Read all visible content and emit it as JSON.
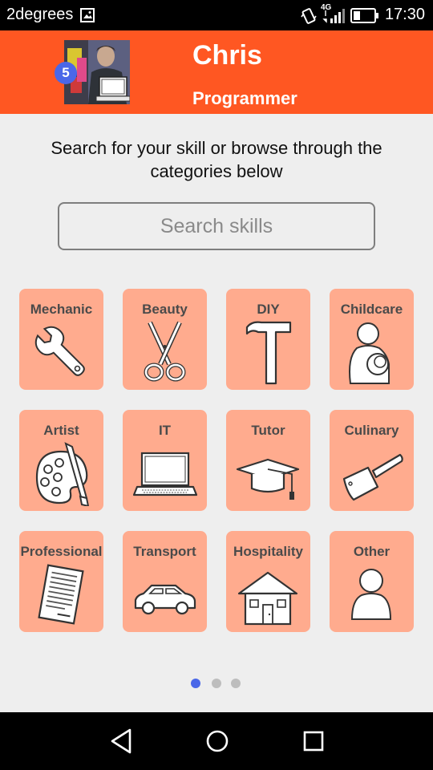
{
  "status_bar": {
    "carrier": "2degrees",
    "network": "4G",
    "time": "17:30"
  },
  "header": {
    "name": "Chris",
    "role": "Programmer",
    "notification_count": "5",
    "accent_color": "#ff5722"
  },
  "intro_text": "Search for your skill or browse through the categories below",
  "search": {
    "placeholder": "Search skills",
    "value": ""
  },
  "categories": [
    {
      "label": "Mechanic",
      "icon": "wrench-icon"
    },
    {
      "label": "Beauty",
      "icon": "scissors-icon"
    },
    {
      "label": "DIY",
      "icon": "hammer-icon"
    },
    {
      "label": "Childcare",
      "icon": "parent-child-icon"
    },
    {
      "label": "Artist",
      "icon": "palette-icon"
    },
    {
      "label": "IT",
      "icon": "laptop-icon"
    },
    {
      "label": "Tutor",
      "icon": "graduation-cap-icon"
    },
    {
      "label": "Culinary",
      "icon": "cleaver-icon"
    },
    {
      "label": "Professional",
      "icon": "document-icon"
    },
    {
      "label": "Transport",
      "icon": "car-icon"
    },
    {
      "label": "Hospitality",
      "icon": "house-icon"
    },
    {
      "label": "Other",
      "icon": "person-icon"
    }
  ],
  "pagination": {
    "pages": 3,
    "current": 1,
    "active_color": "#4a67e8",
    "inactive_color": "#bdbdbd"
  },
  "tile_color": "#ffab8e",
  "nav_bar": [
    "back-icon",
    "home-icon",
    "recents-icon"
  ]
}
